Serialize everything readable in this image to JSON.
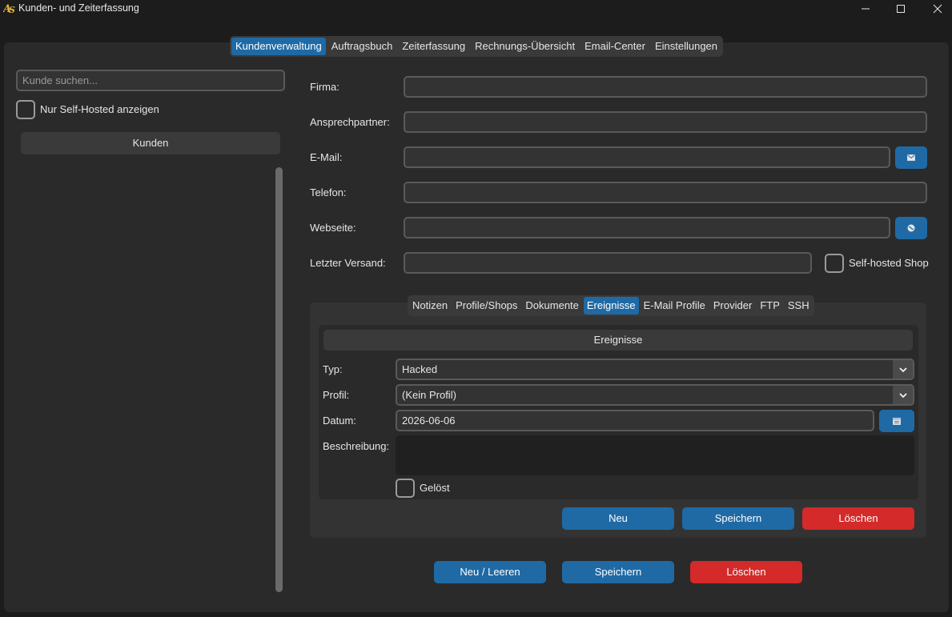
{
  "window": {
    "title": "Kunden- und Zeiterfassung",
    "app_icon_glyph": "AS"
  },
  "main_tabs": [
    {
      "label": "Kundenverwaltung",
      "active": true
    },
    {
      "label": "Auftragsbuch",
      "active": false
    },
    {
      "label": "Zeiterfassung",
      "active": false
    },
    {
      "label": "Rechnungs-Übersicht",
      "active": false
    },
    {
      "label": "Email-Center",
      "active": false
    },
    {
      "label": "Einstellungen",
      "active": false
    }
  ],
  "sidebar": {
    "search_placeholder": "Kunde suchen...",
    "self_hosted_filter_label": "Nur Self-Hosted anzeigen",
    "self_hosted_filter_checked": false,
    "list_header": "Kunden"
  },
  "form": {
    "firma_label": "Firma:",
    "firma_value": "",
    "ansprechpartner_label": "Ansprechpartner:",
    "ansprechpartner_value": "",
    "email_label": "E-Mail:",
    "email_value": "",
    "telefon_label": "Telefon:",
    "telefon_value": "",
    "webseite_label": "Webseite:",
    "webseite_value": "",
    "letzter_versand_label": "Letzter Versand:",
    "letzter_versand_value": "",
    "self_hosted_label": "Self-hosted Shop",
    "self_hosted_checked": false
  },
  "sub_tabs": [
    {
      "label": "Notizen",
      "active": false
    },
    {
      "label": "Profile/Shops",
      "active": false
    },
    {
      "label": "Dokumente",
      "active": false
    },
    {
      "label": "Ereignisse",
      "active": true
    },
    {
      "label": "E-Mail Profile",
      "active": false
    },
    {
      "label": "Provider",
      "active": false
    },
    {
      "label": "FTP",
      "active": false
    },
    {
      "label": "SSH",
      "active": false
    }
  ],
  "events": {
    "header": "Ereignisse",
    "typ_label": "Typ:",
    "typ_value": "Hacked",
    "profil_label": "Profil:",
    "profil_value": "(Kein Profil)",
    "datum_label": "Datum:",
    "datum_value": "2026-06-06",
    "beschreibung_label": "Beschreibung:",
    "beschreibung_value": "",
    "geloest_label": "Gelöst",
    "geloest_checked": false,
    "btn_neu": "Neu",
    "btn_speichern": "Speichern",
    "btn_loeschen": "Löschen"
  },
  "footer": {
    "btn_neu_leeren": "Neu / Leeren",
    "btn_speichern": "Speichern",
    "btn_loeschen": "Löschen"
  },
  "colors": {
    "accent": "#1f6aa5",
    "danger": "#d42a2a",
    "background": "#1c1c1c",
    "panel": "#2a2a2a"
  }
}
